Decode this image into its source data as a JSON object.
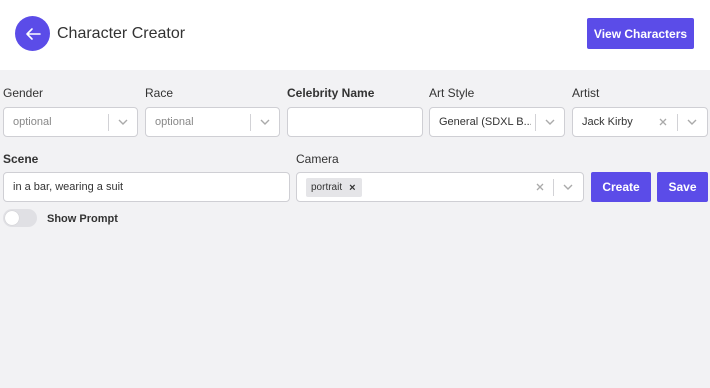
{
  "header": {
    "title": "Character Creator",
    "view_button": "View Characters"
  },
  "form": {
    "gender": {
      "label": "Gender",
      "placeholder": "optional"
    },
    "race": {
      "label": "Race",
      "placeholder": "optional"
    },
    "celebrity": {
      "label": "Celebrity Name",
      "value": ""
    },
    "art_style": {
      "label": "Art Style",
      "value": "General (SDXL B..."
    },
    "artist": {
      "label": "Artist",
      "value": "Jack Kirby"
    },
    "scene": {
      "label": "Scene",
      "value": "in a bar, wearing a suit"
    },
    "camera": {
      "label": "Camera",
      "tags": [
        "portrait"
      ]
    }
  },
  "actions": {
    "create": "Create",
    "save": "Save"
  },
  "show_prompt": {
    "label": "Show Prompt",
    "enabled": false
  },
  "colors": {
    "accent": "#5b4ce8",
    "background": "#f2f2f4"
  },
  "icons": {
    "back": "arrow-left-icon",
    "dropdown": "chevron-down-icon",
    "clear": "close-icon"
  }
}
